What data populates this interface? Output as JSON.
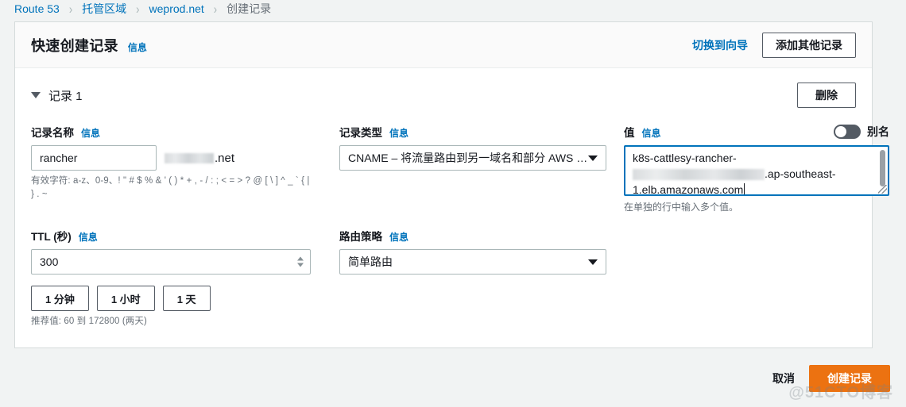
{
  "breadcrumb": {
    "items": [
      {
        "label": "Route 53",
        "current": false
      },
      {
        "label": "托管区域",
        "current": false
      },
      {
        "label": "weprod.net",
        "current": false
      },
      {
        "label": "创建记录",
        "current": true
      }
    ],
    "separator": "›"
  },
  "panel": {
    "title": "快速创建记录",
    "info_label": "信息",
    "switch_to_wizard": "切换到向导",
    "add_another_record": "添加其他记录"
  },
  "record": {
    "title": "记录 1",
    "delete_label": "删除",
    "name": {
      "label": "记录名称",
      "info_label": "信息",
      "value": "rancher",
      "suffix_redacted": true,
      "suffix_visible": ".net",
      "hint": "有效字符: a-z、0-9、! \" # $ % & ' ( ) * + , - / : ; < = > ? @ [ \\ ] ^ _ ` { | } . ~"
    },
    "type": {
      "label": "记录类型",
      "info_label": "信息",
      "selected": "CNAME – 将流量路由到另一域名和部分 AWS …"
    },
    "value": {
      "label": "值",
      "info_label": "信息",
      "alias_toggle_label": "别名",
      "alias_toggle_on": false,
      "line1": "k8s-cattlesy-rancher-",
      "line2_redacted": true,
      "line2_visible": ".ap-southeast-",
      "line3": "1.elb.amazonaws.com",
      "hint": "在单独的行中输入多个值。"
    },
    "ttl": {
      "label": "TTL (秒)",
      "info_label": "信息",
      "value": "300",
      "quick_buttons": [
        "1 分钟",
        "1 小时",
        "1 天"
      ],
      "hint": "推荐值: 60 到 172800 (两天)"
    },
    "routing": {
      "label": "路由策略",
      "info_label": "信息",
      "selected": "简单路由"
    }
  },
  "footer": {
    "cancel_label": "取消",
    "create_label": "创建记录"
  },
  "watermark": "@51CTO博客",
  "colors": {
    "link": "#0073bb",
    "primary": "#ec7211",
    "border": "#aab7b8",
    "page_bg": "#f1f3f3"
  }
}
